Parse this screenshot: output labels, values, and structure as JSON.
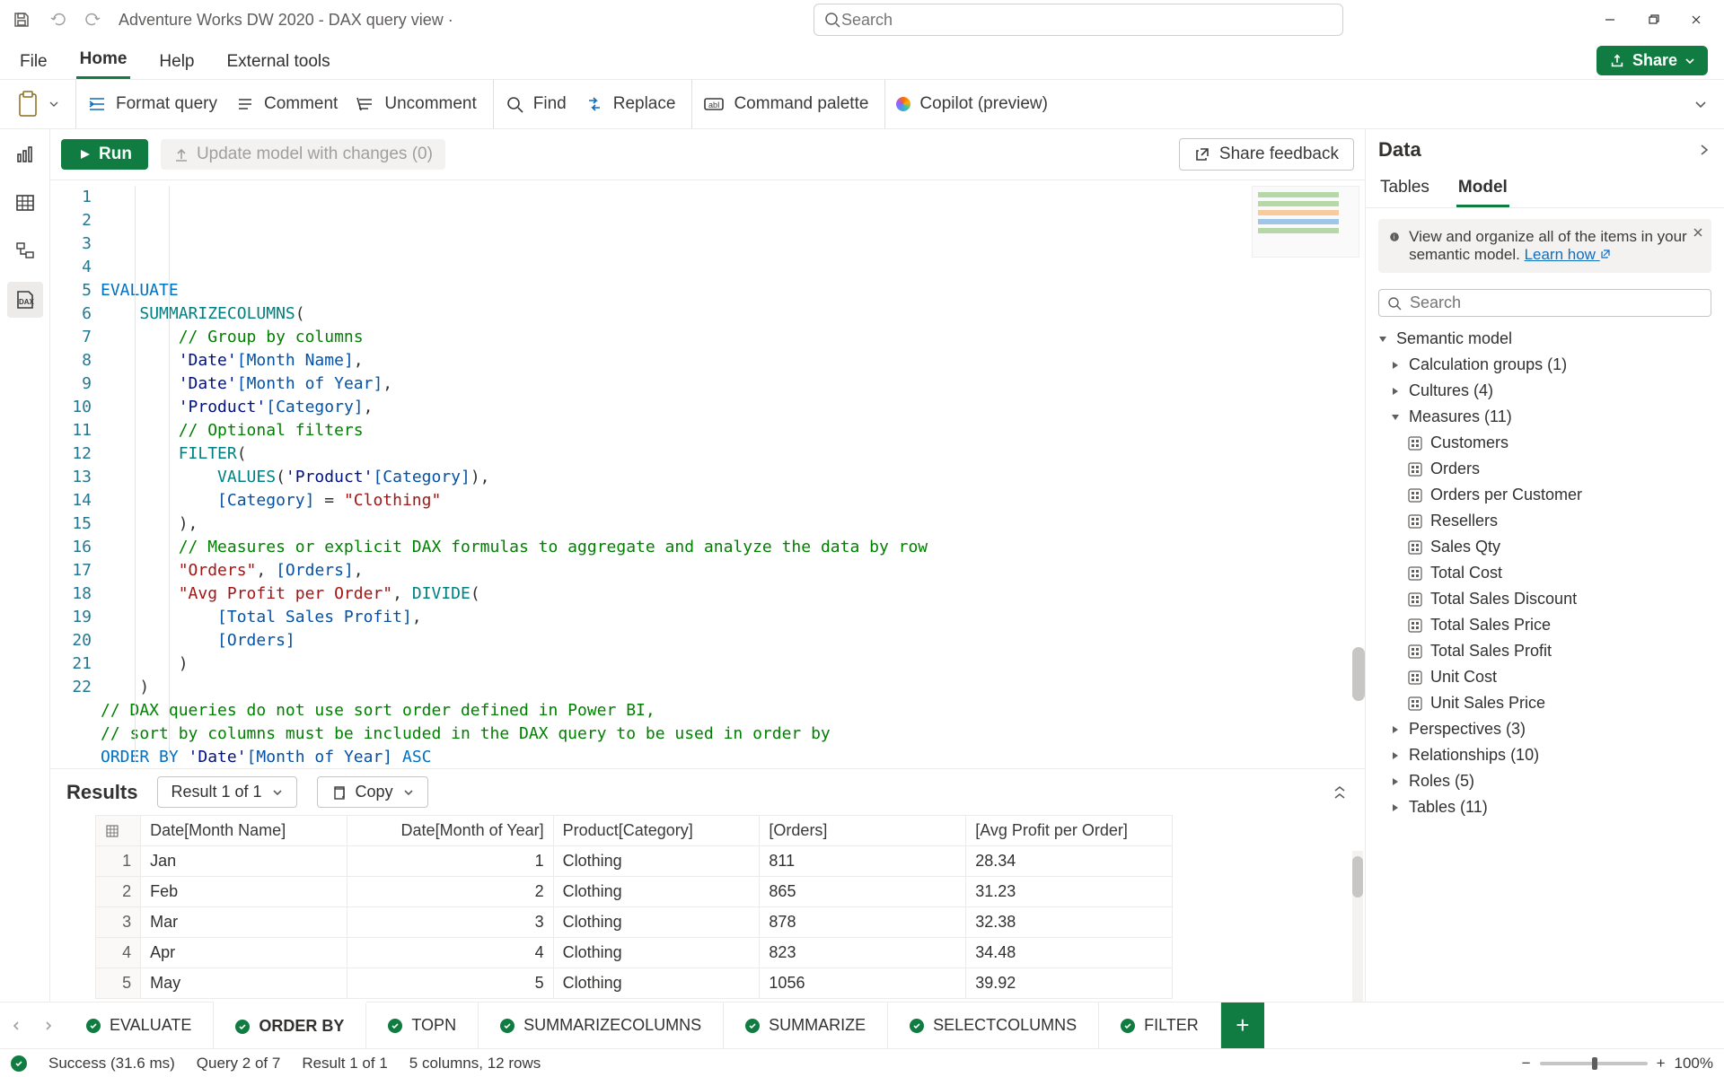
{
  "titlebar": {
    "title": "Adventure Works DW 2020 - DAX query view ·",
    "search_placeholder": "Search"
  },
  "menu": {
    "file": "File",
    "home": "Home",
    "help": "Help",
    "external": "External tools",
    "share": "Share"
  },
  "ribbon": {
    "format": "Format query",
    "comment": "Comment",
    "uncomment": "Uncomment",
    "find": "Find",
    "replace": "Replace",
    "palette": "Command palette",
    "copilot": "Copilot (preview)"
  },
  "actions": {
    "run": "Run",
    "update": "Update model with changes (0)",
    "feedback": "Share feedback"
  },
  "code_lines": [
    "EVALUATE",
    "    SUMMARIZECOLUMNS(",
    "        // Group by columns",
    "        'Date'[Month Name],",
    "        'Date'[Month of Year],",
    "        'Product'[Category],",
    "        // Optional filters",
    "        FILTER(",
    "            VALUES('Product'[Category]),",
    "            [Category] = \"Clothing\"",
    "        ),",
    "        // Measures or explicit DAX formulas to aggregate and analyze the data by row",
    "        \"Orders\", [Orders],",
    "        \"Avg Profit per Order\", DIVIDE(",
    "            [Total Sales Profit],",
    "            [Orders]",
    "        )",
    "    )",
    "// DAX queries do not use sort order defined in Power BI,",
    "// sort by columns must be included in the DAX query to be used in order by",
    "ORDER BY 'Date'[Month of Year] ASC",
    ""
  ],
  "results": {
    "title": "Results",
    "result_label": "Result 1 of 1",
    "copy": "Copy",
    "columns": [
      "Date[Month Name]",
      "Date[Month of Year]",
      "Product[Category]",
      "[Orders]",
      "[Avg Profit per Order]"
    ],
    "rows": [
      [
        "Jan",
        "1",
        "Clothing",
        "811",
        "28.34"
      ],
      [
        "Feb",
        "2",
        "Clothing",
        "865",
        "31.23"
      ],
      [
        "Mar",
        "3",
        "Clothing",
        "878",
        "32.38"
      ],
      [
        "Apr",
        "4",
        "Clothing",
        "823",
        "34.48"
      ],
      [
        "May",
        "5",
        "Clothing",
        "1056",
        "39.92"
      ]
    ]
  },
  "data_pane": {
    "title": "Data",
    "tab_tables": "Tables",
    "tab_model": "Model",
    "info_text": "View and organize all of the items in your semantic model. ",
    "info_link": "Learn how",
    "search_placeholder": "Search",
    "root": "Semantic model",
    "groups": {
      "calc": "Calculation groups (1)",
      "cultures": "Cultures (4)",
      "measures": "Measures (11)",
      "perspectives": "Perspectives (3)",
      "relationships": "Relationships (10)",
      "roles": "Roles (5)",
      "tables": "Tables (11)"
    },
    "measures": [
      "Customers",
      "Orders",
      "Orders per Customer",
      "Resellers",
      "Sales Qty",
      "Total Cost",
      "Total Sales Discount",
      "Total Sales Price",
      "Total Sales Profit",
      "Unit Cost",
      "Unit Sales Price"
    ]
  },
  "query_tabs": [
    "EVALUATE",
    "ORDER BY",
    "TOPN",
    "SUMMARIZECOLUMNS",
    "SUMMARIZE",
    "SELECTCOLUMNS",
    "FILTER"
  ],
  "query_tabs_active": 1,
  "status": {
    "success": "Success (31.6 ms)",
    "query": "Query 2 of 7",
    "result": "Result 1 of 1",
    "shape": "5 columns, 12 rows",
    "zoom": "100%"
  }
}
